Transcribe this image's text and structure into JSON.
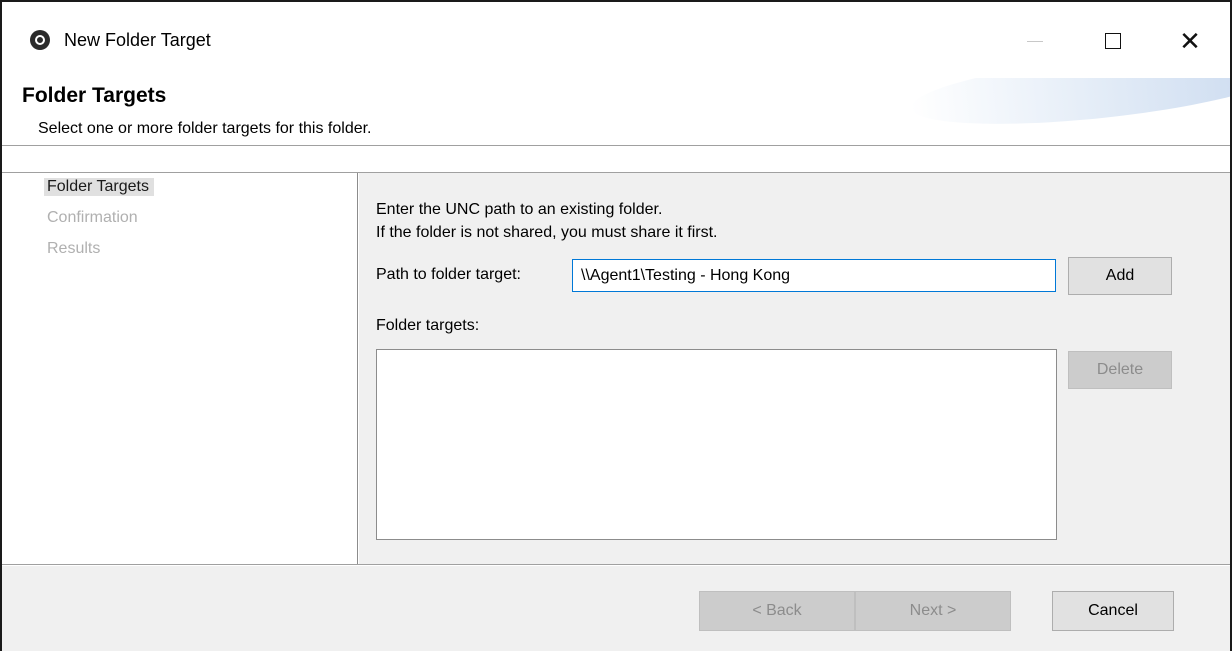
{
  "window": {
    "title": "New Folder Target",
    "icon": "app-logo-icon"
  },
  "banner": {
    "title": "Folder Targets",
    "description": "Select one or more folder targets for this folder."
  },
  "nav": {
    "items": [
      {
        "label": "Folder Targets",
        "active": true
      },
      {
        "label": "Confirmation",
        "active": false
      },
      {
        "label": "Results",
        "active": false
      }
    ]
  },
  "main": {
    "instruction_line1": "Enter the UNC path to an existing folder.",
    "instruction_line2": "If the folder is not shared, you must share it first.",
    "path_label": "Path to folder target:",
    "path_value": "\\\\Agent1\\Testing - Hong Kong",
    "add_label": "Add",
    "targets_label": "Folder targets:",
    "delete_label": "Delete",
    "targets": []
  },
  "footer": {
    "back_label": "< Back",
    "next_label": "Next >",
    "cancel_label": "Cancel"
  },
  "colors": {
    "accent": "#0078d7",
    "panel_bg": "#f0f0f0",
    "disabled_text": "#8c8c8c"
  }
}
